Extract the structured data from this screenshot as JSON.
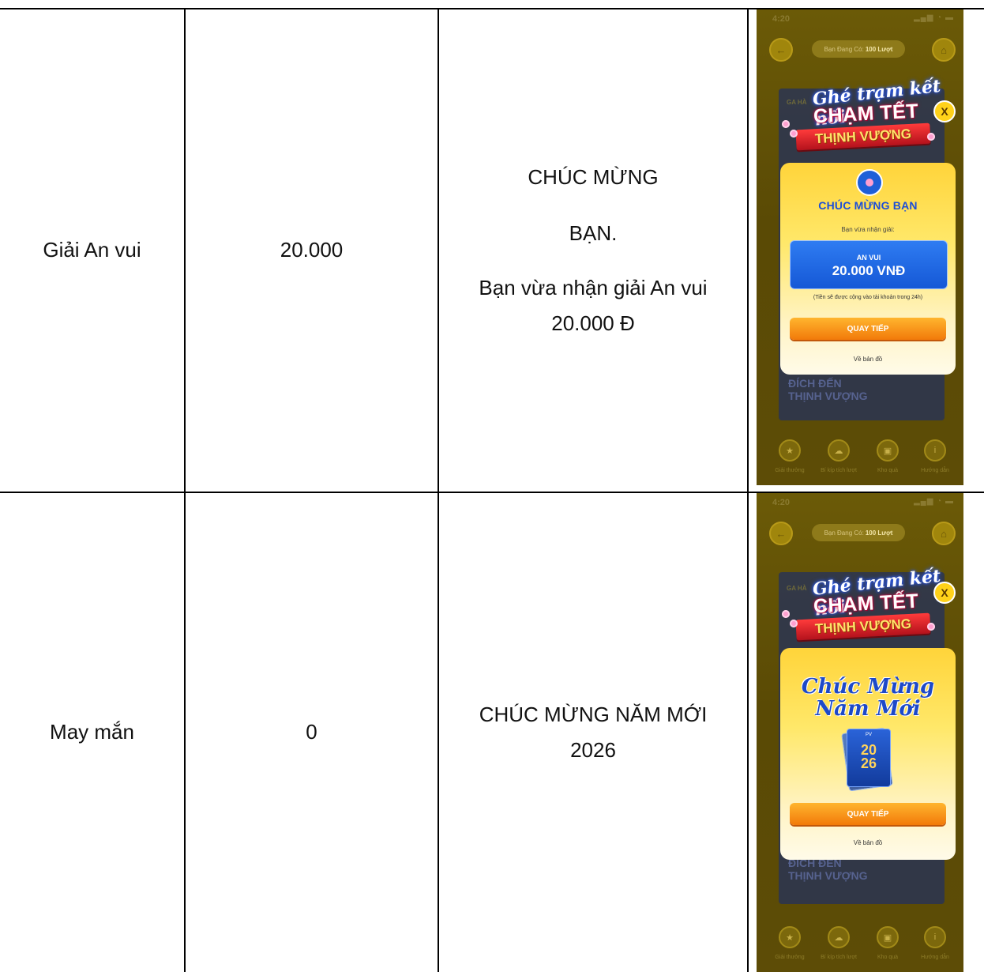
{
  "rows": [
    {
      "prize_name": "Giải An vui",
      "amount": "20.000",
      "message_lines": [
        "CHÚC MỪNG",
        "BẠN.",
        "Bạn vừa nhận giải An vui",
        "20.000 Đ"
      ],
      "screen": {
        "status_time": "4:20",
        "turns_prefix": "Bạn Đang Có:",
        "turns_value": "100 Lượt",
        "banner_script": "Ghé trạm kết nối",
        "banner_main": "CHẠM TẾT",
        "banner_ribbon": "THỊNH VƯỢNG",
        "close_label": "X",
        "modal_title": "CHÚC MỪNG BẠN",
        "modal_subtitle": "Bạn vừa nhận giải:",
        "prize_label": "AN VUI",
        "prize_value": "20.000 VNĐ",
        "prize_note": "(Tiền sẽ được cộng vào tài khoản trong 24h)",
        "cta_label": "QUAY TIẾP",
        "map_link": "Về bản đồ",
        "bg_heading": "ĐÍCH ĐẾN\nTHỊNH VƯỢNG",
        "bg_label": "GA HÀ",
        "nav": [
          "Giải thưởng",
          "Bí kíp tích lượt",
          "Kho quà",
          "Hướng dẫn"
        ]
      }
    },
    {
      "prize_name": "May mắn",
      "amount": "0",
      "message_lines": [
        "CHÚC MỪNG NĂM MỚI",
        "2026"
      ],
      "screen": {
        "status_time": "4:20",
        "turns_prefix": "Bạn Đang Có:",
        "turns_value": "100 Lượt",
        "banner_script": "Ghé trạm kết nối",
        "banner_main": "CHẠM TẾT",
        "banner_ribbon": "THỊNH VƯỢNG",
        "close_label": "X",
        "greeting_line1": "Chúc Mừng",
        "greeting_line2": "Năm Mới",
        "calendar_year": "20\n26",
        "calendar_brand": "PV",
        "cta_label": "QUAY TIẾP",
        "map_link": "Về bản đồ",
        "bg_heading": "ĐÍCH ĐẾN\nTHỊNH VƯỢNG",
        "bg_label": "GA HÀ",
        "nav": [
          "Giải thưởng",
          "Bí kíp tích lượt",
          "Kho quà",
          "Hướng dẫn"
        ]
      }
    }
  ]
}
